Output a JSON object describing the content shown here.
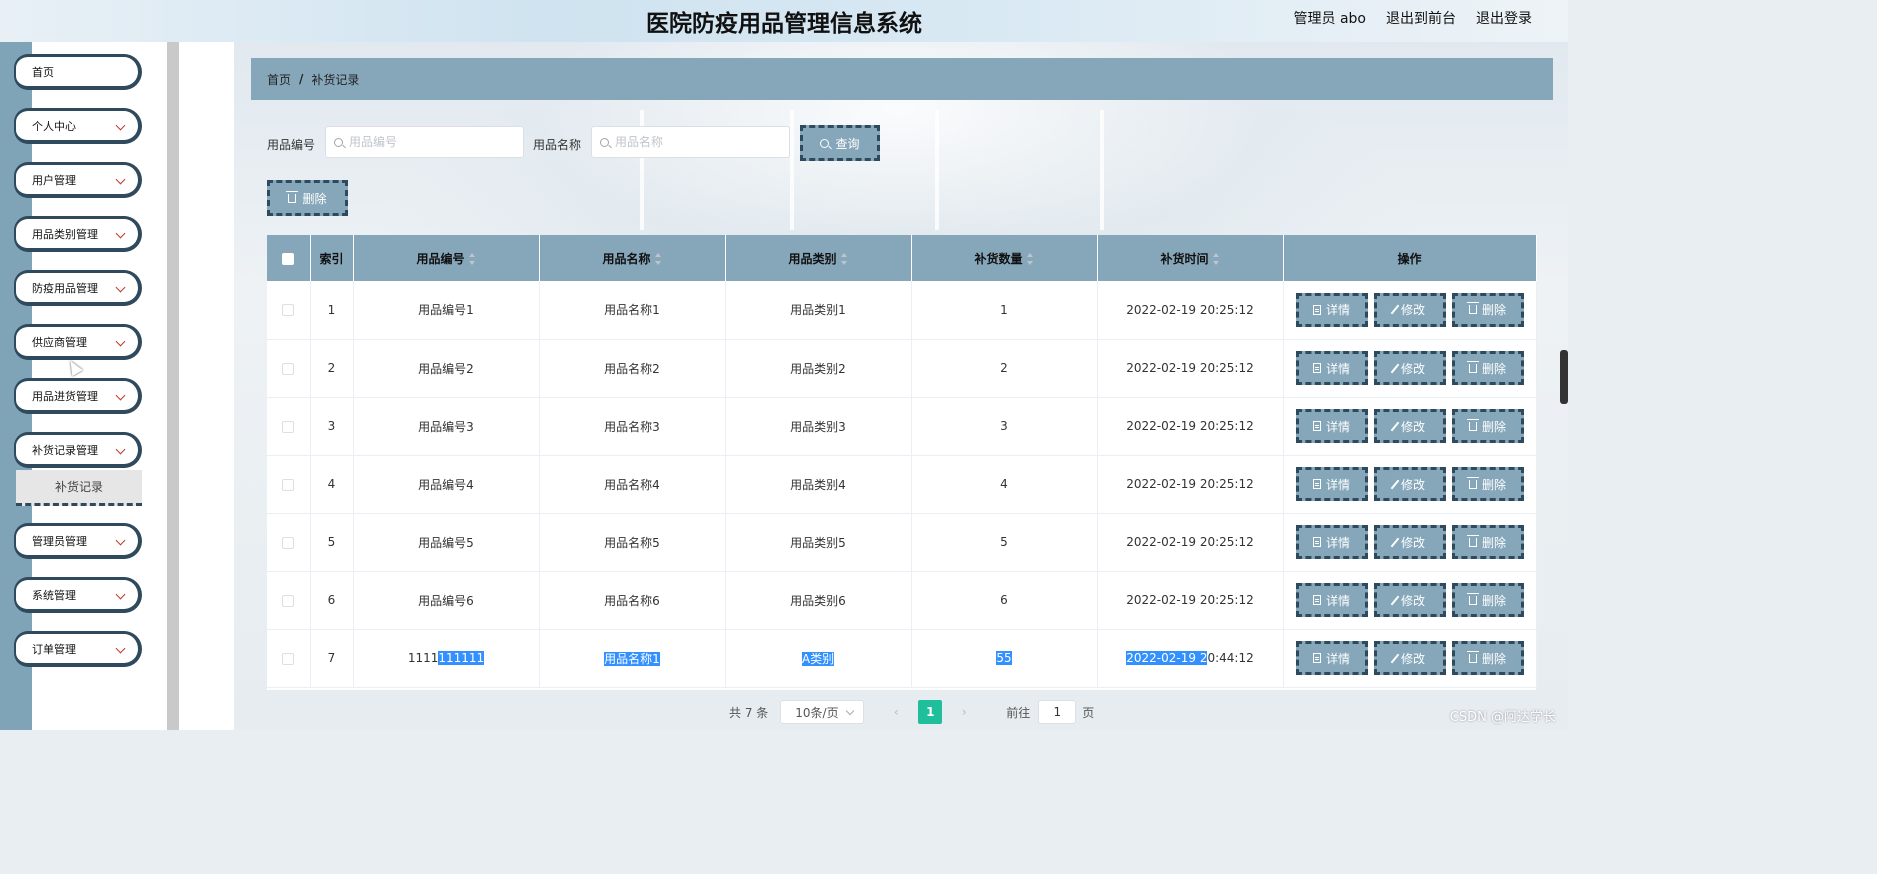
{
  "header": {
    "title": "医院防疫用品管理信息系统",
    "nav": [
      "管理员 abo",
      "退出到前台",
      "退出登录"
    ]
  },
  "sidebar": {
    "items": [
      {
        "label": "首页",
        "chevron": false
      },
      {
        "label": "个人中心",
        "chevron": true
      },
      {
        "label": "用户管理",
        "chevron": true
      },
      {
        "label": "用品类别管理",
        "chevron": true
      },
      {
        "label": "防疫用品管理",
        "chevron": true
      },
      {
        "label": "供应商管理",
        "chevron": true
      },
      {
        "label": "用品进货管理",
        "chevron": true
      },
      {
        "label": "补货记录管理",
        "chevron": true
      },
      {
        "label": "管理员管理",
        "chevron": true
      },
      {
        "label": "系统管理",
        "chevron": true
      },
      {
        "label": "订单管理",
        "chevron": true
      }
    ],
    "submenu_active": "补货记录"
  },
  "breadcrumb": {
    "home": "首页",
    "sep": "/",
    "current": "补货记录"
  },
  "search": {
    "code_label": "用品编号",
    "code_placeholder": "用品编号",
    "name_label": "用品名称",
    "name_placeholder": "用品名称",
    "query_button": "查询"
  },
  "toolbar": {
    "delete_button": "删除"
  },
  "table": {
    "headers": [
      "索引",
      "用品编号",
      "用品名称",
      "用品类别",
      "补货数量",
      "补货时间",
      "操作"
    ],
    "rows": [
      {
        "index": "1",
        "code": "用品编号1",
        "name": "用品名称1",
        "category": "用品类别1",
        "qty": "1",
        "time": "2022-02-19 20:25:12"
      },
      {
        "index": "2",
        "code": "用品编号2",
        "name": "用品名称2",
        "category": "用品类别2",
        "qty": "2",
        "time": "2022-02-19 20:25:12"
      },
      {
        "index": "3",
        "code": "用品编号3",
        "name": "用品名称3",
        "category": "用品类别3",
        "qty": "3",
        "time": "2022-02-19 20:25:12"
      },
      {
        "index": "4",
        "code": "用品编号4",
        "name": "用品名称4",
        "category": "用品类别4",
        "qty": "4",
        "time": "2022-02-19 20:25:12"
      },
      {
        "index": "5",
        "code": "用品编号5",
        "name": "用品名称5",
        "category": "用品类别5",
        "qty": "5",
        "time": "2022-02-19 20:25:12"
      },
      {
        "index": "6",
        "code": "用品编号6",
        "name": "用品名称6",
        "category": "用品类别6",
        "qty": "6",
        "time": "2022-02-19 20:25:12"
      }
    ],
    "last_row": {
      "index": "7",
      "code_plain": "1111",
      "code_hl": "111111",
      "name": "用品名称1",
      "category": "A类别",
      "qty": "55",
      "time_hl": "2022-02-19 2",
      "time_plain": "0:44:12"
    },
    "actions": {
      "detail": "详情",
      "edit": "修改",
      "delete": "删除"
    }
  },
  "pagination": {
    "total": "共 7 条",
    "page_size": "10条/页",
    "prev": "‹",
    "current_page": "1",
    "next": "›",
    "goto_label": "前往",
    "goto_value": "1",
    "page_suffix": "页"
  },
  "watermark": "CSDN @阿达学长",
  "colors": {
    "accent": "#86a7ba",
    "border_dark": "#2f4a5d",
    "page_active": "#1fbf9b",
    "highlight": "#3390ff"
  }
}
